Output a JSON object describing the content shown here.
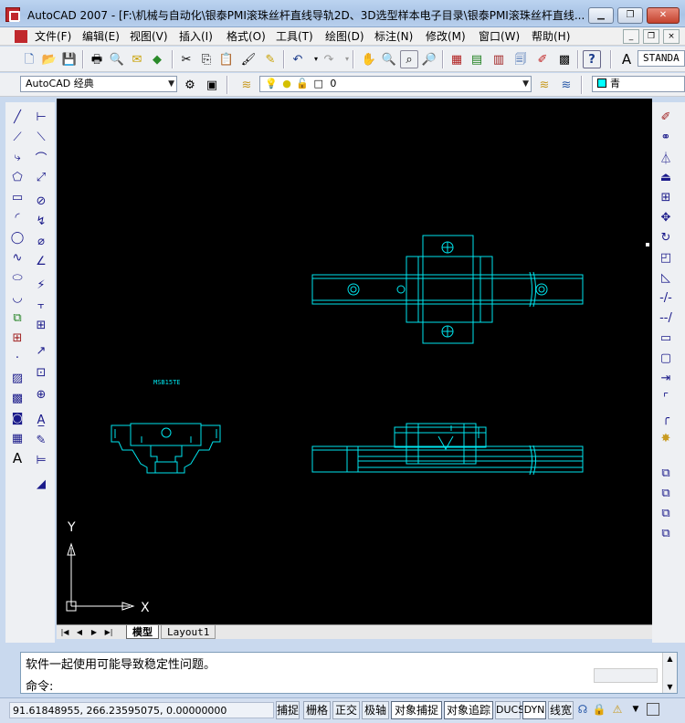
{
  "window": {
    "title": "AutoCAD 2007 - [F:\\机械与自动化\\银泰PMI滚珠丝杆直线导轨2D、3D选型样本电子目录\\银泰PMI滚珠丝杆直线..."
  },
  "menu": {
    "items": [
      "文件(F)",
      "编辑(E)",
      "视图(V)",
      "插入(I)",
      "格式(O)",
      "工具(T)",
      "绘图(D)",
      "标注(N)",
      "修改(M)",
      "窗口(W)",
      "帮助(H)"
    ]
  },
  "toolbars": {
    "text_style": "STANDA",
    "workspace": "AutoCAD 经典",
    "layer": "0",
    "color": "青"
  },
  "drawing": {
    "label": "MSB15TE",
    "ucs_x": "X",
    "ucs_y": "Y",
    "accent_color": "#00e5ee"
  },
  "tabs": [
    "模型",
    "Layout1"
  ],
  "command": {
    "history": "软件一起使用可能导致稳定性问题。",
    "prompt": "命令:"
  },
  "status": {
    "coords": "91.61848955, 266.23595075, 0.00000000",
    "buttons": [
      "捕捉",
      "栅格",
      "正交",
      "极轴",
      "对象捕捉",
      "对象追踪",
      "DUCS",
      "DYN",
      "线宽"
    ]
  },
  "icons": {
    "title": [
      "autocad-app-icon"
    ],
    "window_buttons": [
      "minimize-icon",
      "restore-icon",
      "close-icon"
    ],
    "standard_toolbar": [
      "new-icon",
      "open-icon",
      "save-icon",
      "print-icon",
      "plot-preview-icon",
      "publish-icon",
      "3d-dwf-icon",
      "cut-icon",
      "copy-icon",
      "paste-icon",
      "match-properties-icon",
      "block-editor-icon",
      "undo-icon",
      "redo-icon",
      "pan-icon",
      "zoom-realtime-icon",
      "zoom-window-icon",
      "zoom-previous-icon",
      "properties-icon",
      "design-center-icon",
      "tool-palettes-icon",
      "sheet-set-icon",
      "markup-icon",
      "calculator-icon",
      "help-icon",
      "text-style-icon"
    ],
    "draw_toolbar": [
      "line-icon",
      "construction-line-icon",
      "polyline-icon",
      "polygon-icon",
      "rectangle-icon",
      "arc-icon",
      "circle-icon",
      "spline-icon",
      "ellipse-icon",
      "ellipse-arc-icon",
      "insert-block-icon",
      "make-block-icon",
      "point-icon",
      "hatch-icon",
      "gradient-icon",
      "region-icon",
      "table-icon",
      "multiline-text-icon"
    ],
    "dimension_toolbar": [
      "linear-dim-icon",
      "aligned-dim-icon",
      "arc-length-icon",
      "ordinate-icon",
      "radius-icon",
      "jogged-icon",
      "diameter-icon",
      "angular-icon",
      "quick-dim-icon",
      "baseline-icon",
      "continue-icon",
      "quick-leader-icon",
      "tolerance-icon",
      "center-mark-icon",
      "dim-edit-icon",
      "dim-text-edit-icon",
      "dim-update-icon",
      "dim-style-icon"
    ],
    "modify_toolbar": [
      "erase-icon",
      "copy-object-icon",
      "mirror-icon",
      "offset-icon",
      "array-icon",
      "move-icon",
      "rotate-icon",
      "scale-icon",
      "stretch-icon",
      "trim-icon",
      "extend-icon",
      "break-at-point-icon",
      "break-icon",
      "join-icon",
      "chamfer-icon",
      "fillet-icon",
      "explode-icon",
      "draworder-front-icon",
      "draworder-back-icon",
      "draworder-above-icon",
      "draworder-under-icon"
    ]
  }
}
